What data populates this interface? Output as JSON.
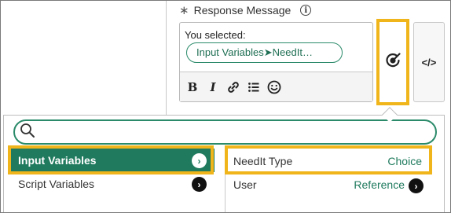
{
  "field": {
    "required_mark": "∗",
    "label": "Response Message",
    "info_glyph": "i"
  },
  "editor": {
    "text": "You selected:",
    "pill": "Input Variables➤NeedIt…",
    "toolbar": {
      "bold": "B",
      "italic": "I",
      "link_icon": "link-icon",
      "list_icon": "bulleted-list-icon",
      "emoji_icon": "emoji-icon"
    }
  },
  "side_buttons": {
    "variable_picker_icon": "data-pill-picker-icon",
    "code_label": "</>"
  },
  "popup": {
    "search": {
      "value": "",
      "placeholder": ""
    },
    "categories": [
      {
        "label": "Input Variables",
        "selected": true
      },
      {
        "label": "Script Variables",
        "selected": false
      }
    ],
    "variables": [
      {
        "name": "NeedIt Type",
        "type": "Choice",
        "has_children": false
      },
      {
        "name": "User",
        "type": "Reference",
        "has_children": true
      }
    ],
    "chevron_glyph": "›"
  },
  "colors": {
    "accent_green": "#1f7a5e",
    "highlight": "#f0b51a"
  }
}
